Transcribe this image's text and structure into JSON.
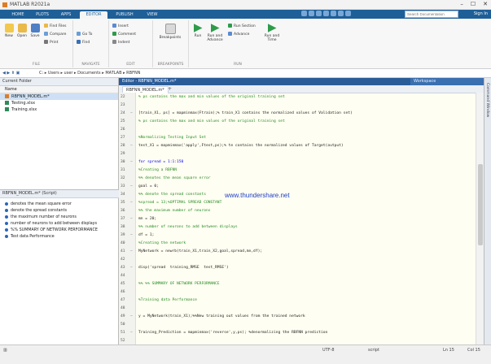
{
  "window": {
    "title": "MATLAB R2021a",
    "controls": [
      "–",
      "☐",
      "✕"
    ]
  },
  "ribbon_tabs": [
    "HOME",
    "PLOTS",
    "APPS",
    "EDITOR",
    "PUBLISH",
    "VIEW"
  ],
  "search": {
    "placeholder": "Search Documentation"
  },
  "signin": "Sign In",
  "ribbon": {
    "file": {
      "new": "New",
      "open": "Open",
      "save": "Save",
      "find_files": "Find Files",
      "compare": "Compare",
      "print": "Print",
      "label": "FILE"
    },
    "navigate": {
      "go_to": "Go To",
      "find": "Find",
      "label": "NAVIGATE"
    },
    "edit": {
      "insert": "Insert",
      "comment": "Comment",
      "indent": "Indent",
      "label": "EDIT"
    },
    "breakpoints": {
      "btn": "Breakpoints",
      "label": "BREAKPOINTS"
    },
    "run": {
      "run": "Run",
      "run_advance": "Run and Advance",
      "run_section": "Run Section",
      "advance": "Advance",
      "run_time": "Run and Time",
      "label": "RUN"
    }
  },
  "address": {
    "path": "C: ▸ Users ▸ user ▸ Documents ▸ MATLAB ▸ RBFNN"
  },
  "current_folder": {
    "title": "Current Folder",
    "name_header": "Name",
    "files": [
      "RBFNN_MODEL.m*",
      "Testing.xlsx",
      "Training.xlsx"
    ]
  },
  "detail_panel": {
    "title": "RBFNN_MODEL.m* (Script)",
    "items": [
      "denotes the mean square error",
      "denote the spread constants",
      "the maximum number of neurons",
      "number of neurons to add between displays",
      "%% SUMMARY OF NETWORK PERFORMANCE",
      "Test data Performance"
    ]
  },
  "editor": {
    "header": "Editor - RBFNN_MODEL.m*",
    "workspace": "Workspace",
    "tab": "RBFNN_MODEL.m*",
    "lines": [
      {
        "n": "22",
        "d": "",
        "t": "% ps contains the max and min values of the original training set",
        "c": "cm"
      },
      {
        "n": "23",
        "d": "",
        "t": "",
        "c": ""
      },
      {
        "n": "24",
        "d": "–",
        "t": "[train_X1, ps] = mapminmax(Ftrain);% train_X1 contains the normalized values of Validation set)",
        "c": ""
      },
      {
        "n": "25",
        "d": "",
        "t": "% ps contains the max and min values of the original training set",
        "c": "cm"
      },
      {
        "n": "26",
        "d": "",
        "t": "",
        "c": ""
      },
      {
        "n": "27",
        "d": "",
        "t": "%Normalizing Testing Input Set",
        "c": "cm"
      },
      {
        "n": "28",
        "d": "–",
        "t": "test_X1 = mapminmax('apply',Ftest,ps);% te contains the normalized values of Target(output)",
        "c": ""
      },
      {
        "n": "29",
        "d": "",
        "t": "",
        "c": ""
      },
      {
        "n": "30",
        "d": "–",
        "t": "for spread = 1:1:150",
        "c": "kw"
      },
      {
        "n": "31",
        "d": "",
        "t": "%Creating a RBFNN",
        "c": "cm"
      },
      {
        "n": "32",
        "d": "",
        "t": "%% denotes the mean square error",
        "c": "cm"
      },
      {
        "n": "33",
        "d": "–",
        "t": "goal = 0;",
        "c": ""
      },
      {
        "n": "34",
        "d": "",
        "t": "%% denote the spread constants",
        "c": "cm"
      },
      {
        "n": "35",
        "d": "–",
        "t": "%spread = 13;%OPTIMAL SPREAD CONSTANT",
        "c": "cm"
      },
      {
        "n": "36",
        "d": "",
        "t": "%% the maximum number of neurons",
        "c": "cm"
      },
      {
        "n": "37",
        "d": "–",
        "t": "mn = 20;",
        "c": ""
      },
      {
        "n": "38",
        "d": "",
        "t": "%% number of neurons to add between displays",
        "c": "cm"
      },
      {
        "n": "39",
        "d": "–",
        "t": "df = 1;",
        "c": ""
      },
      {
        "n": "40",
        "d": "",
        "t": "%Creating the network",
        "c": "cm"
      },
      {
        "n": "41",
        "d": "–",
        "t": "MyNetwork = newrb(train_X1,train_X2,goal,spread,mn,df);",
        "c": ""
      },
      {
        "n": "42",
        "d": "",
        "t": "",
        "c": ""
      },
      {
        "n": "43",
        "d": "–",
        "t": "disp('spread  training_RMSE  test_RMSE')",
        "c": ""
      },
      {
        "n": "44",
        "d": "",
        "t": "",
        "c": ""
      },
      {
        "n": "45",
        "d": "",
        "t": "%% %% SUMMARY OF NETWORK PERFORMANCE",
        "c": "cm"
      },
      {
        "n": "46",
        "d": "",
        "t": "",
        "c": ""
      },
      {
        "n": "47",
        "d": "",
        "t": "%Training data Performance",
        "c": "cm"
      },
      {
        "n": "48",
        "d": "",
        "t": "",
        "c": ""
      },
      {
        "n": "49",
        "d": "–",
        "t": "y = MyNetwork(train_X1);%%New training out values from the trained network",
        "c": ""
      },
      {
        "n": "50",
        "d": "",
        "t": "",
        "c": ""
      },
      {
        "n": "51",
        "d": "–",
        "t": "Training_Prediction = mapminmax('reverse',y,ps); %denormalizing the RBFNN prediction",
        "c": ""
      },
      {
        "n": "52",
        "d": "",
        "t": "",
        "c": ""
      }
    ]
  },
  "watermark": "www.thundershare.net",
  "status": {
    "encoding": "UTF-8",
    "type": "script",
    "ln": "Ln 15",
    "col": "Col 15"
  },
  "right_strip": "Command Window"
}
